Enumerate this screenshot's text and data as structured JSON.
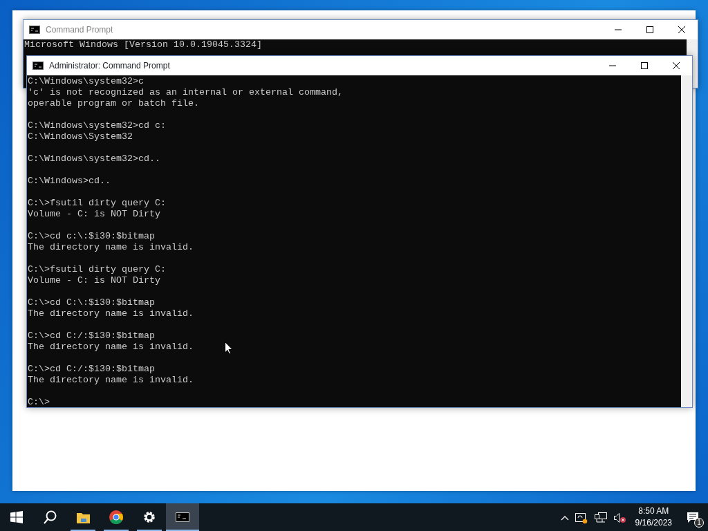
{
  "back_window": {
    "title": "Command Prompt",
    "console_lines": [
      "Microsoft Windows [Version 10.0.19045.3324]"
    ]
  },
  "front_window": {
    "title": "Administrator: Command Prompt",
    "entries": [
      {
        "prompt": "C:\\Windows\\system32>c",
        "output": [
          "'c' is not recognized as an internal or external command,",
          "operable program or batch file."
        ]
      },
      {
        "prompt": "C:\\Windows\\system32>cd c:",
        "output": [
          "C:\\Windows\\System32"
        ]
      },
      {
        "prompt": "C:\\Windows\\system32>cd.."
      },
      {
        "prompt": "C:\\Windows>cd.."
      },
      {
        "prompt": "C:\\>fsutil dirty query C:",
        "output": [
          "Volume - C: is NOT Dirty"
        ]
      },
      {
        "prompt": "C:\\>cd c:\\:$i30:$bitmap",
        "output": [
          "The directory name is invalid."
        ]
      },
      {
        "prompt": "C:\\>fsutil dirty query C:",
        "output": [
          "Volume - C: is NOT Dirty"
        ]
      },
      {
        "prompt": "C:\\>cd C:\\:$i30:$bitmap",
        "output": [
          "The directory name is invalid."
        ]
      },
      {
        "prompt": "C:\\>cd C:/:$i30:$bitmap",
        "output": [
          "The directory name is invalid."
        ]
      },
      {
        "prompt": "C:\\>cd C:/:$i30:$bitmap",
        "output": [
          "The directory name is invalid."
        ]
      },
      {
        "prompt": "C:\\>"
      }
    ]
  },
  "taskbar": {
    "apps": [
      {
        "kind": "search",
        "selected": false
      },
      {
        "kind": "folder",
        "selected": false
      },
      {
        "kind": "chrome",
        "selected": false
      },
      {
        "kind": "settings",
        "selected": false
      },
      {
        "kind": "terminal",
        "selected": true
      }
    ],
    "time": "8:50 AM",
    "date": "9/16/2023",
    "notification_count": "1"
  }
}
